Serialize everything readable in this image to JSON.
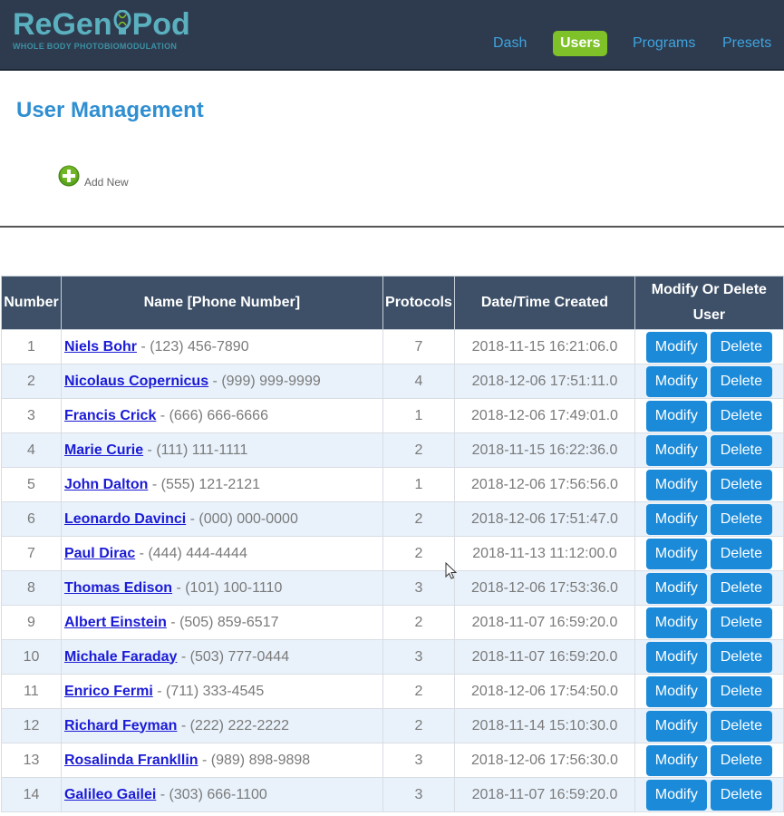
{
  "header": {
    "logo_left": "ReGen",
    "logo_right": "Pod",
    "logo_tagline": "WHOLE BODY PHOTOBIOMODULATION",
    "nav": [
      {
        "label": "Dash",
        "active": false
      },
      {
        "label": "Users",
        "active": true
      },
      {
        "label": "Programs",
        "active": false
      },
      {
        "label": "Presets",
        "active": false
      }
    ]
  },
  "page": {
    "title": "User Management",
    "add_new_label": "Add New"
  },
  "table": {
    "headers": {
      "number": "Number",
      "name": "Name [Phone Number]",
      "protocols": "Protocols",
      "date": "Date/Time Created",
      "actions": "Modify Or Delete User"
    },
    "modify_label": "Modify",
    "delete_label": "Delete",
    "rows": [
      {
        "number": "1",
        "name": "Niels Bohr",
        "phone": " - (123) 456-7890",
        "protocols": "7",
        "created": "2018-11-15 16:21:06.0"
      },
      {
        "number": "2",
        "name": "Nicolaus Copernicus",
        "phone": " - (999) 999-9999",
        "protocols": "4",
        "created": "2018-12-06 17:51:11.0"
      },
      {
        "number": "3",
        "name": "Francis Crick",
        "phone": " - (666) 666-6666",
        "protocols": "1",
        "created": "2018-12-06 17:49:01.0"
      },
      {
        "number": "4",
        "name": "Marie Curie",
        "phone": " - (111) 111-1111",
        "protocols": "2",
        "created": "2018-11-15 16:22:36.0"
      },
      {
        "number": "5",
        "name": "John Dalton",
        "phone": " - (555) 121-2121",
        "protocols": "1",
        "created": "2018-12-06 17:56:56.0"
      },
      {
        "number": "6",
        "name": "Leonardo Davinci",
        "phone": " - (000) 000-0000",
        "protocols": "2",
        "created": "2018-12-06 17:51:47.0"
      },
      {
        "number": "7",
        "name": "Paul Dirac",
        "phone": " - (444) 444-4444",
        "protocols": "2",
        "created": "2018-11-13 11:12:00.0"
      },
      {
        "number": "8",
        "name": "Thomas Edison",
        "phone": " - (101) 100-1110",
        "protocols": "3",
        "created": "2018-12-06 17:53:36.0"
      },
      {
        "number": "9",
        "name": "Albert Einstein",
        "phone": " - (505) 859-6517",
        "protocols": "2",
        "created": "2018-11-07 16:59:20.0"
      },
      {
        "number": "10",
        "name": "Michale Faraday",
        "phone": " - (503) 777-0444",
        "protocols": "3",
        "created": "2018-11-07 16:59:20.0"
      },
      {
        "number": "11",
        "name": "Enrico Fermi",
        "phone": " - (711) 333-4545",
        "protocols": "2",
        "created": "2018-12-06 17:54:50.0"
      },
      {
        "number": "12",
        "name": "Richard Feyman",
        "phone": " - (222) 222-2222",
        "protocols": "2",
        "created": "2018-11-14 15:10:30.0"
      },
      {
        "number": "13",
        "name": "Rosalinda Frankllin",
        "phone": " - (989) 898-9898",
        "protocols": "3",
        "created": "2018-12-06 17:56:30.0"
      },
      {
        "number": "14",
        "name": "Galileo Gailei",
        "phone": " - (303) 666-1100",
        "protocols": "3",
        "created": "2018-11-07 16:59:20.0"
      }
    ]
  },
  "colors": {
    "header_bg": "#2e3b4e",
    "nav_active": "#7ec128",
    "nav_link": "#3ea4e0",
    "title": "#2f8fd1",
    "table_header": "#3d5068",
    "row_alt": "#e9f2fb",
    "button": "#1a8ad9",
    "name_link": "#1b1bd6"
  },
  "icons": {
    "add": "plus-circle-icon",
    "logo": "bulb-icon",
    "cursor": "mouse-cursor-icon"
  }
}
